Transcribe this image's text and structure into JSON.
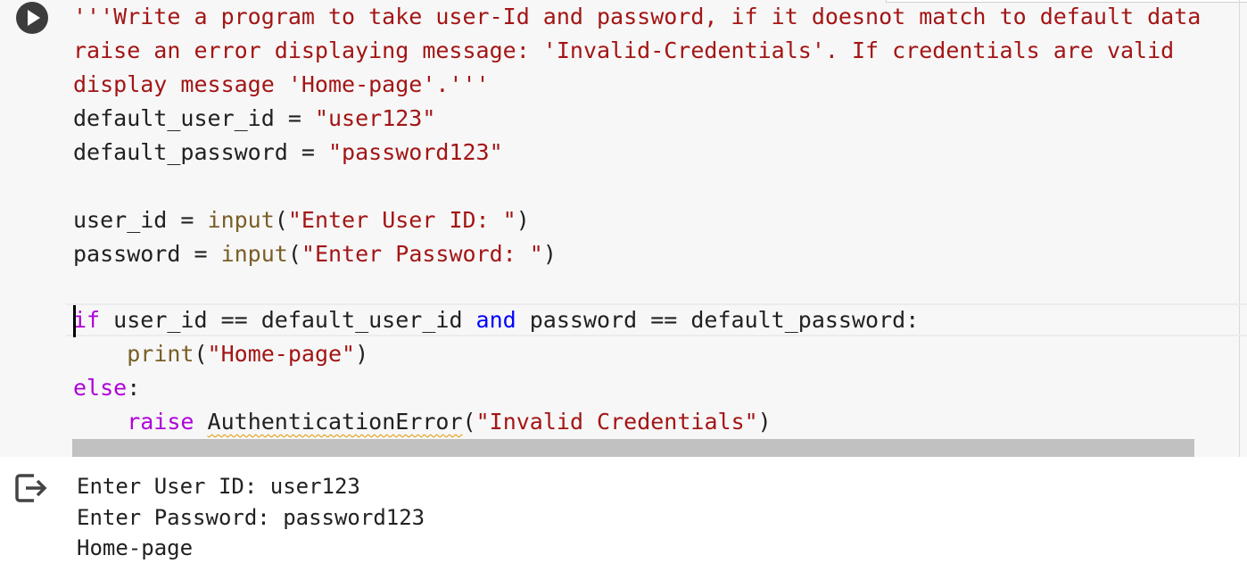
{
  "cell": {
    "run_button_label": "Run cell",
    "code": {
      "line1": "'''Write a program to take user-Id and password, if it doesnot match to default data",
      "line2": "raise an error displaying message: 'Invalid-Credentials'. If credentials are valid",
      "line3": "display message 'Home-page'.'''",
      "line4": {
        "name": "default_user_id",
        "op": " = ",
        "value": "\"user123\""
      },
      "line5": {
        "name": "default_password",
        "op": " = ",
        "value": "\"password123\""
      },
      "line7": {
        "name": "user_id",
        "op": " = ",
        "fn": "input",
        "open": "(",
        "arg": "\"Enter User ID: \"",
        "close": ")"
      },
      "line8": {
        "name": "password",
        "op": " = ",
        "fn": "input",
        "open": "(",
        "arg": "\"Enter Password: \"",
        "close": ")"
      },
      "line10": {
        "kw": "if",
        "a": " user_id == default_user_id ",
        "and": "and",
        "b": " password == default_password:"
      },
      "line11": {
        "indent": "    ",
        "fn": "print",
        "open": "(",
        "arg": "\"Home-page\"",
        "close": ")"
      },
      "line12": {
        "kw": "else",
        "colon": ":"
      },
      "line13": {
        "indent": "    ",
        "kw": "raise",
        "sp": " ",
        "cls": "AuthenticationError",
        "open": "(",
        "arg": "\"Invalid Credentials\"",
        "close": ")"
      }
    }
  },
  "output": {
    "icon": "output-redirect-icon",
    "lines": [
      "Enter User ID: user123",
      "Enter Password: password123",
      "Home-page"
    ]
  },
  "colors": {
    "string": "#a31515",
    "function": "#795e26",
    "keyword_logic": "#0000ff",
    "keyword_control": "#af00db",
    "warning_squiggle": "#e39400"
  }
}
